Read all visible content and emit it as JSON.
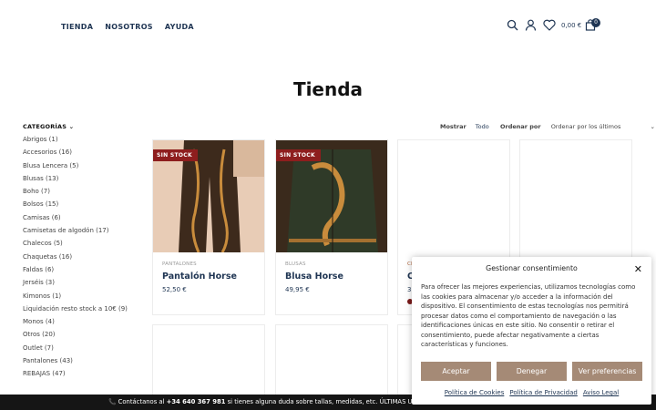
{
  "nav": {
    "items": [
      "TIENDA",
      "NOSOTROS",
      "AYUDA"
    ]
  },
  "header": {
    "cart_total": "0,00 €",
    "cart_count": "0",
    "icons": [
      "search-icon",
      "user-icon",
      "heart-icon",
      "cart-icon"
    ]
  },
  "page": {
    "title": "Tienda"
  },
  "sidebar": {
    "title": "CATEGORÍAS",
    "items": [
      "Abrigos (1)",
      "Accesorios (16)",
      "Blusa Lencera (5)",
      "Blusas (13)",
      "Boho (7)",
      "Bolsos (15)",
      "Camisas (6)",
      "Camisetas de algodón (17)",
      "Chalecos (5)",
      "Chaquetas (16)",
      "Faldas (6)",
      "Jerséis (3)",
      "Kimonos (1)",
      "Liquidación resto stock a 10€ (9)",
      "Monos (4)",
      "Otros (20)",
      "Outlet (7)",
      "Pantalones (43)",
      "REBAJAS (47)"
    ]
  },
  "toolbar": {
    "show_label": "Mostrar",
    "show_value": "Todo",
    "order_label": "Ordenar por",
    "order_value": "Ordenar por los últimos"
  },
  "products": [
    {
      "badge": "SIN STOCK",
      "category": "PANTALONES",
      "name": "Pantalón Horse",
      "price": "52,50 €"
    },
    {
      "badge": "SIN STOCK",
      "category": "BLUSAS",
      "name": "Blusa Horse",
      "price": "49,95 €"
    },
    {
      "category": "CH",
      "name": "C",
      "price": "3"
    }
  ],
  "footer": {
    "prefix": "📞 Contáctanos al ",
    "phone": "+34 640 367 981",
    "suffix": " si tienes alguna duda sobre tallas, medidas, etc. ÚLTIMAS UNIDADES"
  },
  "consent": {
    "title": "Gestionar consentimiento",
    "text": "Para ofrecer las mejores experiencias, utilizamos tecnologías como las cookies para almacenar y/o acceder a la información del dispositivo. El consentimiento de estas tecnologías nos permitirá procesar datos como el comportamiento de navegación o las identificaciones únicas en este sitio. No consentir o retirar el consentimiento, puede afectar negativamente a ciertas características y funciones.",
    "accept": "Aceptar",
    "deny": "Denegar",
    "prefs": "Ver preferencias",
    "links": [
      "Política de Cookies",
      "Política de Privacidad",
      "Aviso Legal"
    ]
  },
  "colors": {
    "brand": "#1f3553",
    "badge": "#8e1e1e",
    "button": "#a58a76",
    "footer": "#151515"
  }
}
